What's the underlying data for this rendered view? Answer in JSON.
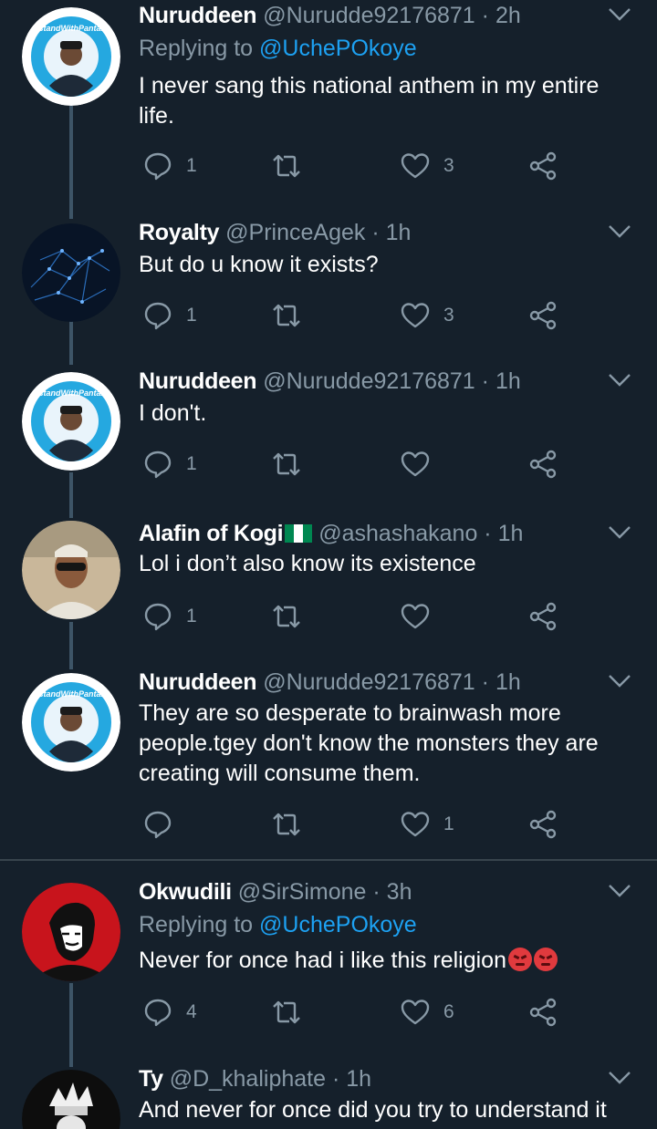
{
  "tweets": [
    {
      "name": "Nuruddeen",
      "handle": "@Nurudde92176871",
      "time": "2h",
      "reply_prefix": "Replying to",
      "reply_to": "@UchePOkoye",
      "text": "I never sang this national anthem in my entire life.",
      "replies": "1",
      "retweets": "",
      "likes": "3",
      "avatar": "istandwithpantami-avatar"
    },
    {
      "name": "Royalty",
      "handle": "@PrinceAgek",
      "time": "1h",
      "text": "But do u know it exists?",
      "replies": "1",
      "retweets": "",
      "likes": "3",
      "avatar": "network-globe-avatar"
    },
    {
      "name": "Nuruddeen",
      "handle": "@Nurudde92176871",
      "time": "1h",
      "text": "I don't.",
      "replies": "1",
      "retweets": "",
      "likes": "",
      "avatar": "istandwithpantami-avatar"
    },
    {
      "name": "Alafin of Kogi",
      "handle": "@ashashakano",
      "time": "1h",
      "text": "Lol i don’t also know its existence",
      "replies": "1",
      "retweets": "",
      "likes": "",
      "avatar": "man-with-sunglasses-avatar",
      "name_emoji": "nigeria-flag"
    },
    {
      "name": "Nuruddeen",
      "handle": "@Nurudde92176871",
      "time": "1h",
      "text": "They are so desperate to brainwash more people.tgey don't know the monsters they are creating will consume them.",
      "replies": "",
      "retweets": "",
      "likes": "1",
      "avatar": "istandwithpantami-avatar"
    },
    {
      "name": "Okwudili",
      "handle": "@SirSimone",
      "time": "3h",
      "reply_prefix": "Replying to",
      "reply_to": "@UchePOkoye",
      "text": "Never for once had i like this religion",
      "text_emoji": "angry-face x2",
      "replies": "4",
      "retweets": "",
      "likes": "6",
      "avatar": "che-guevara-avatar"
    },
    {
      "name": "Ty",
      "handle": "@D_khaliphate",
      "time": "1h",
      "text": "And never for once did you try to understand it",
      "avatar": "anime-character-avatar"
    }
  ],
  "separator": "·",
  "colors": {
    "background": "#15202b",
    "secondary_text": "#8899a6",
    "link": "#1da1f2",
    "divider": "#38444d"
  }
}
